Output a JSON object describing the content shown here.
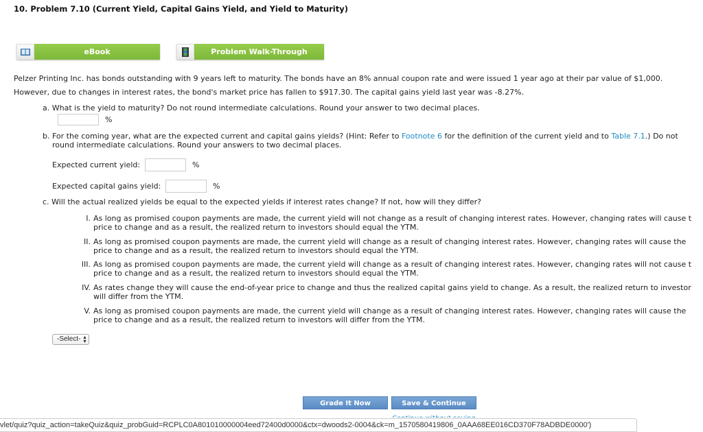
{
  "title": "10.  Problem 7.10 (Current Yield, Capital Gains Yield, and Yield to Maturity)",
  "tools": {
    "ebook": {
      "label": "eBook",
      "icon": "book-icon"
    },
    "walkthrough": {
      "label": "Problem Walk-Through",
      "icon": "film-icon"
    }
  },
  "problem": {
    "line1": "Pelzer Printing Inc. has bonds outstanding with 9 years left to maturity. The bonds have an 8% annual coupon rate and were issued 1 year ago at their par value of $1,000.",
    "line2": "However, due to changes in interest rates, the bond's market price has fallen to $917.30. The capital gains yield last year was -8.27%."
  },
  "part_a": {
    "question": "a. What is the yield to maturity? Do not round intermediate calculations. Round your answer to two decimal places.",
    "input_value": "",
    "unit": "%"
  },
  "part_b": {
    "q_start": "b. For the coming year, what are the expected current and capital gains yields? (Hint: Refer to ",
    "link1": "Footnote 6",
    "q_mid": " for the definition of the current yield and to ",
    "link2": "Table 7.1",
    "q_end": ".) Do not",
    "q_line2": "round intermediate calculations. Round your answers to two decimal places.",
    "current_label": "Expected current yield:",
    "current_value": "",
    "capital_label": "Expected capital gains yield:",
    "capital_value": "",
    "unit": "%"
  },
  "part_c": {
    "question": "c. Will the actual realized yields be equal to the expected yields if interest rates change? If not, how will they differ?",
    "options": [
      {
        "num": "I.",
        "line1": "As long as promised coupon payments are made, the current yield will not change as a result of changing interest rates. However, changing rates will cause t",
        "line2": "price to change and as a result, the realized return to investors should equal the YTM."
      },
      {
        "num": "II.",
        "line1": "As long as promised coupon payments are made, the current yield will change as a result of changing interest rates. However, changing rates will cause the",
        "line2": "price to change and as a result, the realized return to investors should equal the YTM."
      },
      {
        "num": "III.",
        "line1": "As long as promised coupon payments are made, the current yield will change as a result of changing interest rates. However, changing rates will not cause t",
        "line2": "price to change and as a result, the realized return to investors should equal the YTM."
      },
      {
        "num": "IV.",
        "line1": "As rates change they will cause the end-of-year price to change and thus the realized capital gains yield to change. As a result, the realized return to investor",
        "line2": "will differ from the YTM."
      },
      {
        "num": "V.",
        "line1": "As long as promised coupon payments are made, the current yield will change as a result of changing interest rates. However, changing rates will cause the",
        "line2": "price to change and as a result, the realized return to investors will differ from the YTM."
      }
    ],
    "select_value": "-Select-"
  },
  "footer": {
    "grade_label": "Grade It Now",
    "save_label": "Save & Continue",
    "continue_label": "Continue without saving"
  },
  "status_url": "vlet/quiz?quiz_action=takeQuiz&quiz_probGuid=RCPLC0A801010000004eed72400d0000&ctx=dwoods2-0004&ck=m_1570580419806_0AAA68EE016CD370F78ADBDE0000')"
}
